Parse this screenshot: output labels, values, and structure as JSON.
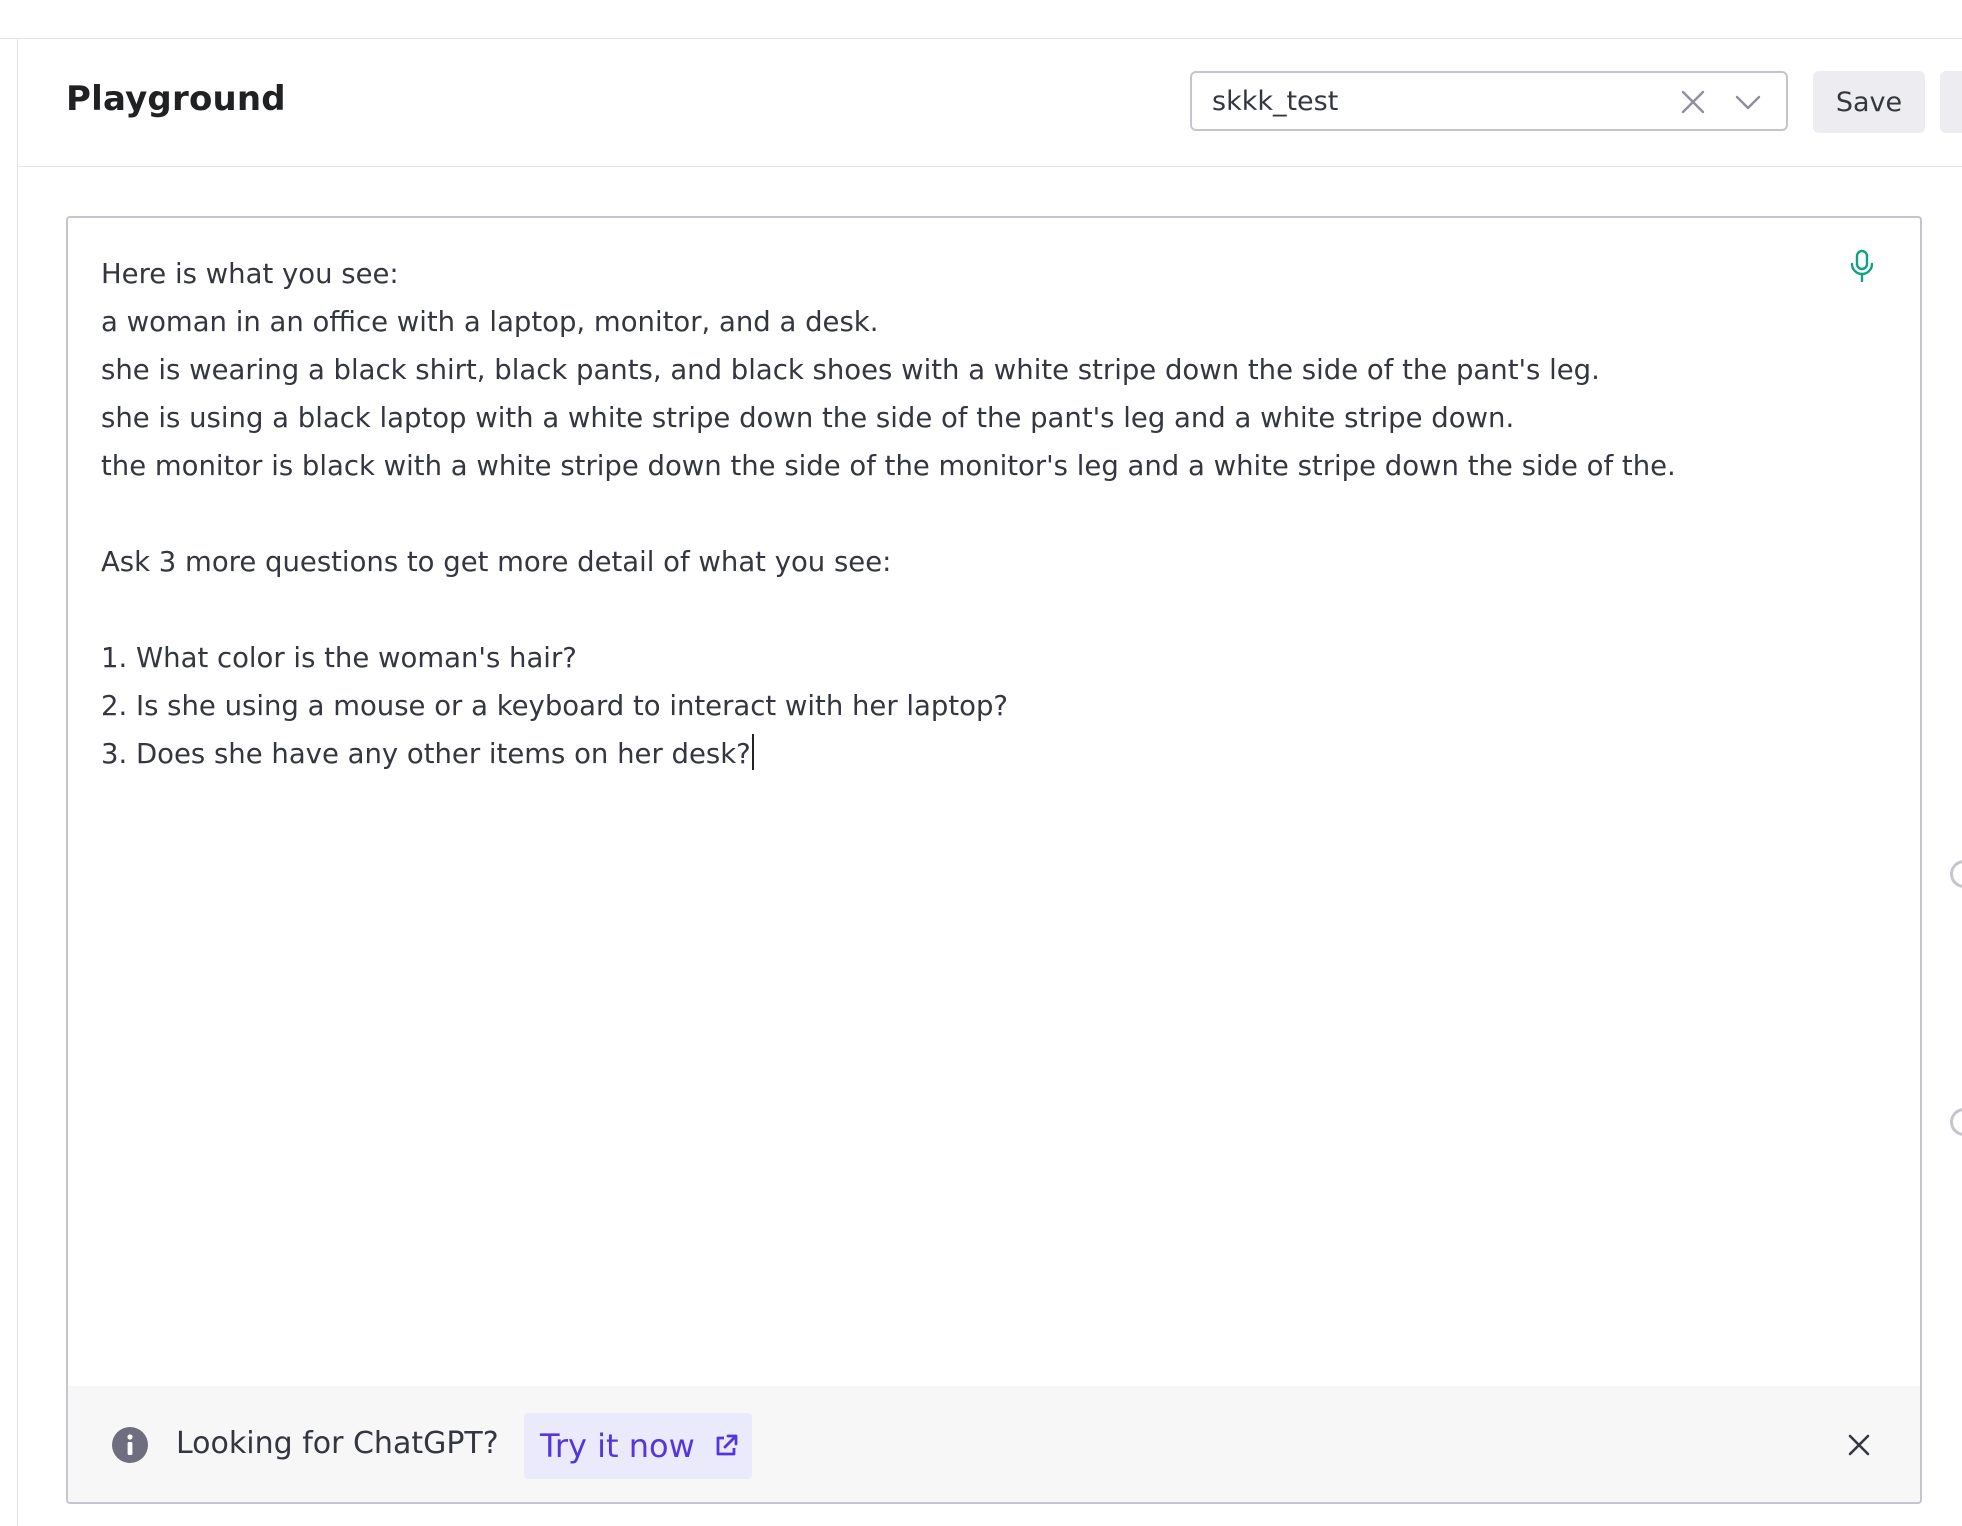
{
  "header": {
    "title": "Playground",
    "preset_value": "skkk_test",
    "save_label": "Save"
  },
  "editor": {
    "prompt": "Here is what you see:\na woman in an office with a laptop, monitor, and a desk.\nshe is wearing a black shirt, black pants, and black shoes with a white stripe down the side of the pant's leg.\nshe is using a black laptop with a white stripe down the side of the pant's leg and a white stripe down.\nthe monitor is black with a white stripe down the side of the monitor's leg and a white stripe down the side of the.\n\nAsk 3 more questions to get more detail of what you see:\n\n1. What color is the woman's hair?\n2. Is she using a mouse or a keyboard to interact with her laptop?\n3. Does she have any other items on her desk?"
  },
  "banner": {
    "text": "Looking for ChatGPT?",
    "link_label": "Try it now"
  },
  "icons": {
    "mic": "microphone-icon",
    "clear": "close-icon",
    "dropdown": "chevron-down-icon",
    "info": "info-icon",
    "external": "external-link-icon",
    "banner_close": "close-icon"
  },
  "colors": {
    "accent_green": "#10a37f",
    "link_purple": "#5436da",
    "link_bg": "#ebe9fc",
    "banner_bg": "#f7f7f8",
    "button_bg": "#ececf1"
  }
}
